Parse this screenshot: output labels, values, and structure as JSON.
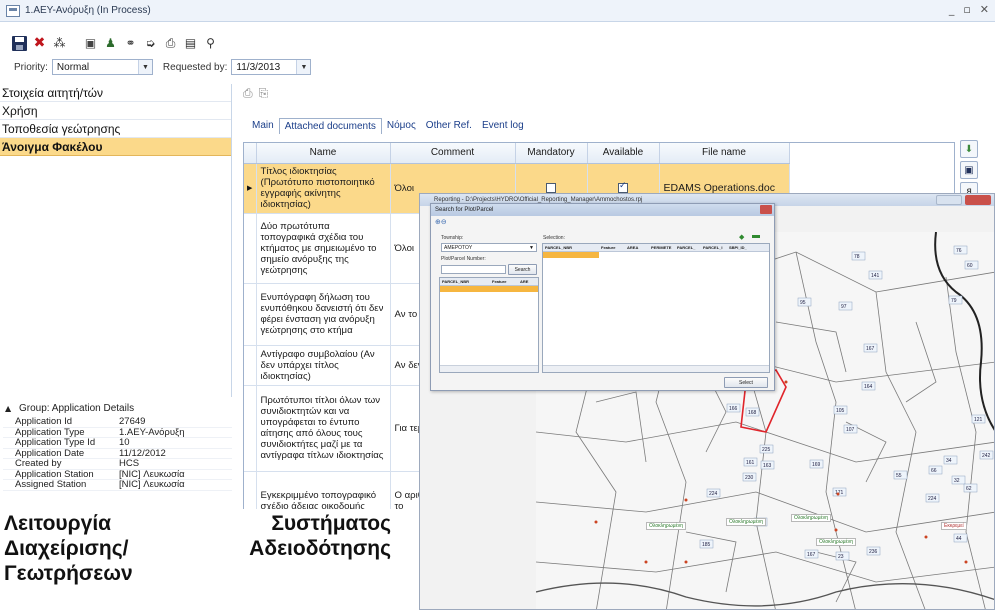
{
  "window": {
    "title": "1.ΑΕΥ-Ανόρυξη (In Process)"
  },
  "toolbar": {
    "icons": [
      "save-icon",
      "delete-icon",
      "hierarchy-icon",
      "properties-icon",
      "user-icon",
      "binoculars-icon",
      "forward-icon",
      "print-icon",
      "document-icon",
      "search-icon"
    ]
  },
  "priority": {
    "label": "Priority:",
    "value": "Normal",
    "requested_label": "Requested by:",
    "requested_value": "11/3/2013"
  },
  "nav": {
    "items": [
      "Στοιχεία αιτητή/τών",
      "Χρήση",
      "Τοποθεσία γεώτρησης",
      "Άνοιγμα Φακέλου"
    ],
    "active_index": 3
  },
  "group": {
    "header": "Group:  Application Details",
    "rows": [
      {
        "k": "Application Id",
        "v": "27649"
      },
      {
        "k": "Application Type",
        "v": "1.ΑΕΥ-Ανόρυξη"
      },
      {
        "k": "Application Type Id",
        "v": "10"
      },
      {
        "k": "Application Date",
        "v": "11/12/2012"
      },
      {
        "k": "Created by",
        "v": "HCS"
      },
      {
        "k": "Application Station",
        "v": "[NIC] Λευκωσία"
      },
      {
        "k": "Assigned Station",
        "v": "[NIC] Λευκωσία"
      }
    ]
  },
  "tabs": [
    "Main",
    "Attached documents",
    "Νόμος",
    "Other Ref.",
    "Event log"
  ],
  "active_tab": 1,
  "grid": {
    "columns": [
      "Name",
      "Comment",
      "Mandatory",
      "Available",
      "File name"
    ],
    "rows": [
      {
        "name": "Τίτλος ιδιοκτησίας (Πρωτότυπο πιστοποιητικό εγγραφής ακίνητης ιδιοκτησίας)",
        "comment": "Όλοι",
        "mandatory": false,
        "available": true,
        "file": "EDAMS Operations.doc",
        "selected": true
      },
      {
        "name": "Δύο πρωτότυπα τοπογραφικά σχέδια του κτήματος με σημειωμένο το σημείο ανόρυξης της γεώτρησης",
        "comment": "Όλοι",
        "mandatory": false,
        "available": false,
        "file": "",
        "selected": false
      },
      {
        "name": "Ενυπόγραφη δήλωση του ενυπόθηκου δανειστή ότι δεν φέρει ένσταση για ανόρυξη γεώτρησης στο κτήμα",
        "comment": "Αν το κτή υποθηκευ",
        "mandatory": false,
        "available": false,
        "file": "",
        "selected": false
      },
      {
        "name": "Αντίγραφο συμβολαίου (Αν δεν υπάρχει τίτλος ιδιοκτησίας)",
        "comment": "Αν δεν υπ ιδιοκτησί",
        "mandatory": false,
        "available": false,
        "file": "",
        "selected": false
      },
      {
        "name": "Πρωτότυποι τίτλοι όλων των συνιδιοκτητών και να υπογράφεται το έντυπο αίτησης από όλους τους συνιδιοκτήτες μαζί με τα αντίγραφα τίτλων ιδιοκτησίας",
        "comment": "Για τεμάχ μερίδια",
        "mandatory": false,
        "available": false,
        "file": "",
        "selected": false
      },
      {
        "name": "Εγκεκριμμένο τοπογραφικό σχέδιο άδειας οικοδομής",
        "comment": "Ο αριθμό είναι διαφ αριθμό το",
        "mandatory": false,
        "available": false,
        "file": "",
        "selected": false
      }
    ]
  },
  "reporting": {
    "title": "Reporting - D:\\Projects\\HYDRO\\Official_Reporting_Manager\\Ammochostos.rpj"
  },
  "search": {
    "title": "Search for Plot/Parcel",
    "township_label": "Township:",
    "township_value": "AMEPOTOY",
    "plot_label": "Plot/Parcel Number:",
    "search_button": "Search",
    "selection_label": "Selection:",
    "left_columns": [
      "PARCEL_NBR",
      "Feature",
      "ARE"
    ],
    "right_columns": [
      "PARCEL_NBR",
      "Feature",
      "AREA",
      "PERIMETE",
      "PARCEL_",
      "PARCEL_I",
      "SBPI_ID_"
    ],
    "select_button": "Select"
  },
  "map": {
    "labels": [
      "Ολοκληρωμένη",
      "Ολοκληρωμένη",
      "Ολοκληρωμένη",
      "Ολοκληρωμένη",
      "Εκκρεμεί"
    ],
    "parcels": [
      "78",
      "141",
      "60",
      "76",
      "95",
      "97",
      "79",
      "167",
      "166",
      "168",
      "105",
      "107",
      "121",
      "225",
      "161",
      "163",
      "169",
      "224",
      "230",
      "171",
      "184",
      "185",
      "236",
      "167",
      "23",
      "44",
      "55",
      "66",
      "34",
      "32",
      "62",
      "224",
      "242",
      "164"
    ]
  },
  "caption": {
    "line1_left": "Λειτουργία",
    "line1_right": "Συστήματος",
    "line2_left": "Διαχείρισης/",
    "line2_right": "Αδειοδότησης",
    "line3": "Γεωτρήσεων"
  }
}
